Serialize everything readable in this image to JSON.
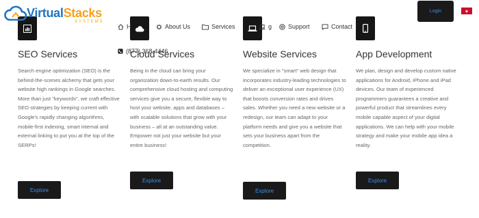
{
  "brand": {
    "name_part1": "Virtual",
    "name_part2": "Stacks",
    "subtitle": "SYSTEMS"
  },
  "nav": {
    "items": [
      {
        "label": "H",
        "icon": "home-icon"
      },
      {
        "label": "About Us",
        "icon": "gear-icon"
      },
      {
        "label": "Services",
        "icon": "folder-icon"
      },
      {
        "label": "g",
        "icon": "laptop-icon"
      },
      {
        "label": "Support",
        "icon": "lifebuoy-icon"
      },
      {
        "label": "Contact",
        "icon": "chat-icon"
      }
    ],
    "phone": "(877) 368-4446"
  },
  "header": {
    "login_label": "Login"
  },
  "colors": {
    "brand_blue": "#1f75c2",
    "brand_orange": "#f5a21a",
    "button_bg": "#1a1a1a",
    "button_text": "#3a8ef0",
    "flag_red": "#c8102e"
  },
  "services": [
    {
      "title": "SEO Services",
      "icon": "chart-icon",
      "description": "Search engine optimization (SEO) is the behind-the-scenes alchemy that gets your website high rankings in Google searches. More than just \"keywords\", we craft effective SEO strategies by keeping current with Google's rapidly changing algorithms, mobile-first indexing, smart internal and external linking to put you at the top of the SERPs!",
      "button": "Explore"
    },
    {
      "title": "Cloud Services",
      "icon": "cloud-icon",
      "description": "Being in the cloud can bring your organization down-to-earth results. Our comprehensive cloud hosting and computing services give you a secure, flexible way to host your website, apps and databases – with scalable solutions that grow with your business – all at an outstanding value. Empower not just your website but your entire business!",
      "button": "Explore"
    },
    {
      "title": "Website Services",
      "icon": "laptop-icon",
      "description": "We specialize in \"smart\" web design that incorporates industry-leading technologies to deliver an exceptional user experience (UX) that boosts conversion rates and drives sales. Whether you need a new website or a redesign, our team can adapt to your platform needs and give you a website that sets your business apart from the competition.",
      "button": "Explore"
    },
    {
      "title": "App Development",
      "icon": "mobile-icon",
      "description": "We plan, design and develop custom native applications for Android, iPhone and iPad devices. Our team of experienced programmers guarantees a creative and powerful product that streamlines every mobile capable aspect of your digital applications. We can help with your mobile strategy and make your mobile app idea a reality.",
      "button": "Explore"
    }
  ]
}
